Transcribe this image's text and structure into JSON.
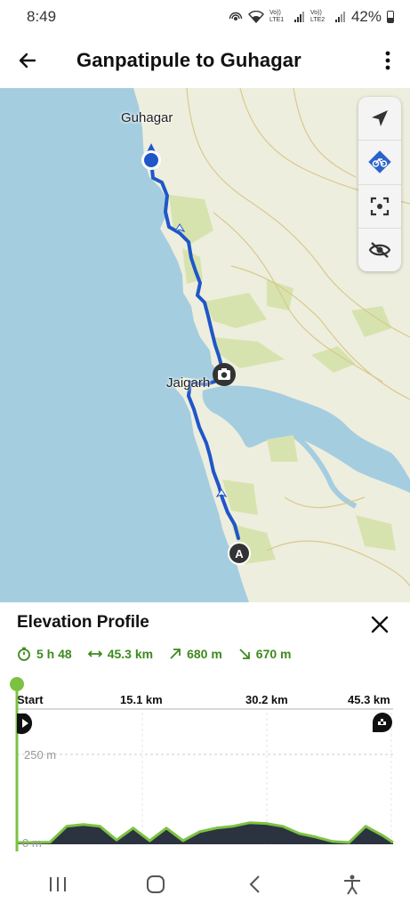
{
  "status_bar": {
    "time": "8:49",
    "net1": "Vo)) LTE1",
    "net2": "Vo)) LTE2",
    "battery": "42%"
  },
  "header": {
    "title": "Ganpatipule to Guhagar"
  },
  "map": {
    "labels": {
      "guhagar": "Guhagar",
      "jaigarh": "Jaigarh"
    },
    "start_marker": "A",
    "route_color": "#1f57c9",
    "sea_color": "#a5cde0",
    "land_color": "#efede0",
    "vegetation_color": "#d7e3ae",
    "controls": [
      "navigation-arrow",
      "bike-mode",
      "recenter",
      "hide-eye"
    ]
  },
  "elevation": {
    "title": "Elevation Profile",
    "stats": {
      "duration": "5 h 48",
      "distance": "45.3 km",
      "ascent": "680 m",
      "descent": "670 m"
    },
    "axis": {
      "start": "Start",
      "d1": "15.1 km",
      "d2": "30.2 km",
      "d3": "45.3 km",
      "y_top": "250 m",
      "y_bottom": "0 m"
    },
    "accent": "#7cc242",
    "fill_color": "#2c3340"
  },
  "chart_data": {
    "type": "area",
    "x": [
      0,
      2,
      4,
      6,
      8,
      10,
      12,
      14,
      16,
      18,
      20,
      22,
      24,
      26,
      28,
      30,
      32,
      34,
      36,
      38,
      40,
      42,
      44,
      45.3
    ],
    "values": [
      5,
      5,
      6,
      50,
      55,
      50,
      12,
      45,
      10,
      45,
      10,
      35,
      45,
      50,
      60,
      58,
      50,
      30,
      20,
      8,
      5,
      50,
      25,
      5
    ],
    "xlabel": "",
    "ylabel": "",
    "xlim": [
      0,
      45.3
    ],
    "ylim": [
      0,
      250
    ]
  }
}
